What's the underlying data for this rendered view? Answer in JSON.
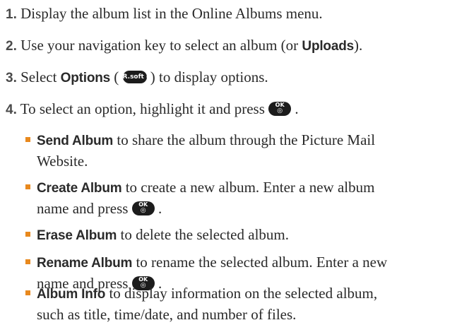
{
  "steps": [
    {
      "num": "1.",
      "text": "Display the album list in the Online Albums menu."
    },
    {
      "num": "2.",
      "pre": "Use your navigation key to select an album (or ",
      "bold": "Uploads",
      "post": ")."
    },
    {
      "num": "3.",
      "pre": "Select ",
      "bold": "Options",
      "mid": " ( ",
      "key": "R.soft ●",
      "post": " ) to display options."
    },
    {
      "num": "4.",
      "pre": "To select an option, highlight it and press ",
      "post": " ."
    }
  ],
  "ok_key": {
    "top": "OK",
    "bottom": "◎"
  },
  "options": [
    {
      "bold": "Send Album",
      "line1": " to share the album through the Picture Mail",
      "line2": "Website."
    },
    {
      "bold": "Create Album",
      "line1": " to create a new album. Enter a new album",
      "line2": "name and press ",
      "line2_post": " ."
    },
    {
      "bold": "Erase Album",
      "line1": " to delete the selected album."
    },
    {
      "bold": "Rename Album",
      "line1": " to rename the selected album. Enter a new",
      "line2": "name and press ",
      "line2_post": " ."
    },
    {
      "bold": "Album Info",
      "line1": " to display information on the selected album,",
      "line2": "such as title, time/date, and number of files."
    }
  ]
}
